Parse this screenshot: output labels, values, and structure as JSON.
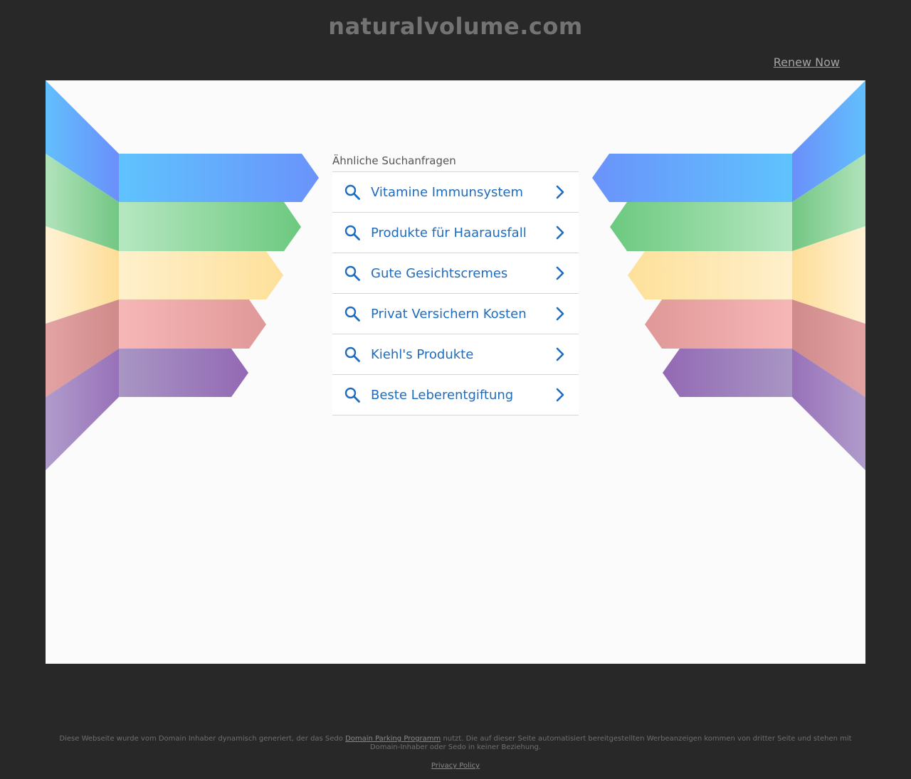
{
  "header": {
    "domain": "naturalvolume.com",
    "renew_label": "Renew Now"
  },
  "related": {
    "label": "Ähnliche Suchanfragen",
    "items": [
      {
        "label": "Vitamine Immunsystem"
      },
      {
        "label": "Produkte für Haarausfall"
      },
      {
        "label": "Gute Gesichtscremes"
      },
      {
        "label": "Privat Versichern Kosten"
      },
      {
        "label": "Kiehl's Produkte"
      },
      {
        "label": "Beste Leberentgiftung"
      }
    ]
  },
  "footer": {
    "text_before": "Diese Webseite wurde vom Domain Inhaber dynamisch generiert, der das Sedo ",
    "link_label": "Domain Parking Programm",
    "text_after": " nutzt. Die auf dieser Seite automatisiert bereitgestellten Werbeanzeigen kommen von dritter Seite und stehen mit Domain-Inhaber oder Sedo in keiner Beziehung.",
    "privacy_label": "Privacy Policy"
  },
  "colors": {
    "background": "#282828",
    "content_bg": "#fbfbfb",
    "link_blue": "#1e6cc0",
    "band_blue": "#5ec0fc",
    "band_green": "#6cc97f",
    "band_yellow": "#fde3a3",
    "band_red": "#f4b4b4",
    "band_purple": "#9a76b9"
  },
  "icons": {
    "item_icon": "search-icon",
    "item_arrow": "chevron-right-icon"
  }
}
